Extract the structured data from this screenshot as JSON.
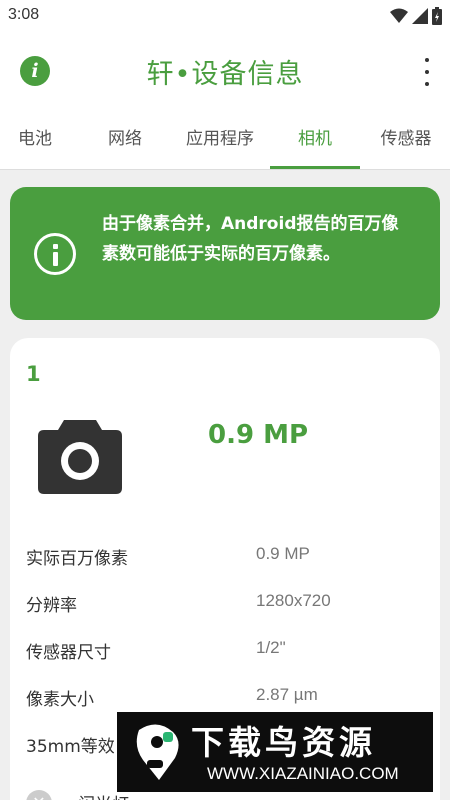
{
  "status_bar": {
    "time": "3:08",
    "icons": [
      "wifi-icon",
      "signal-icon",
      "battery-icon"
    ]
  },
  "app_bar": {
    "title": "轩•设备信息",
    "info_icon": "i",
    "accent_color": "#4a9e3f"
  },
  "tabs": [
    {
      "label": "电池",
      "active": false
    },
    {
      "label": "网络",
      "active": false
    },
    {
      "label": "应用程序",
      "active": false
    },
    {
      "label": "相机",
      "active": true
    },
    {
      "label": "传感器",
      "active": false
    }
  ],
  "notice": {
    "text": "由于像素合并，Android报告的百万像素数可能低于实际的百万像素。"
  },
  "camera": {
    "index": "1",
    "megapixels": "0.9 MP",
    "specs": [
      {
        "label": "实际百万像素",
        "value": "0.9 MP"
      },
      {
        "label": "分辨率",
        "value": "1280x720"
      },
      {
        "label": "传感器尺寸",
        "value": "1/2\""
      },
      {
        "label": "像素大小",
        "value": "2.87 µm"
      },
      {
        "label": "35mm等效",
        "value": ""
      }
    ],
    "flash": {
      "label": "闪光灯",
      "icon": "✕"
    }
  },
  "watermark": {
    "title": "下载鸟资源",
    "url": "WWW.XIAZAINIAO.COM"
  }
}
